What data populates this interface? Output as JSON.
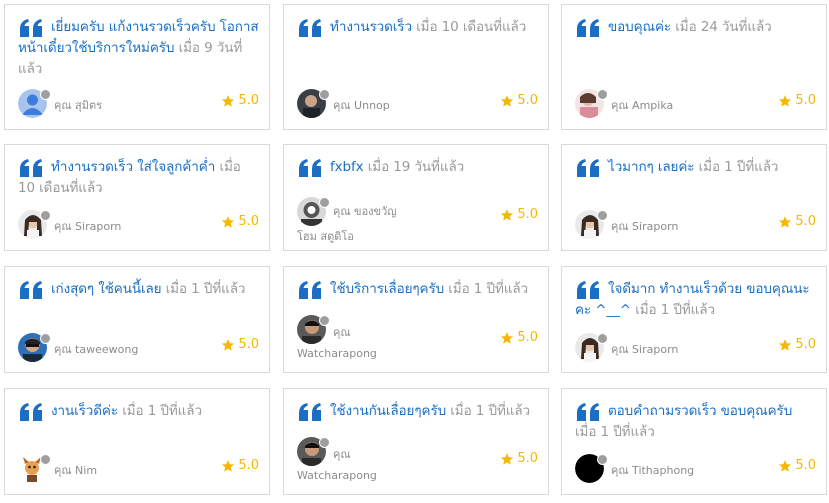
{
  "reviews": [
    {
      "text": "เยี่ยมครับ แก้งานรวดเร็วครับ โอกาสหน้าเดี๋ยวใช้บริการใหม่ครับ",
      "time": "เมื่อ 9 วันที่แล้ว",
      "user": "คุณ สุมิตร",
      "rating": "5.0",
      "avatar": "default-person"
    },
    {
      "text": "ทำงานรวดเร็ว",
      "time": "เมื่อ 10 เดือนที่แล้ว",
      "user": "คุณ Unnop",
      "rating": "5.0",
      "avatar": "photo"
    },
    {
      "text": "ขอบคุณค่ะ",
      "time": "เมื่อ 24 วันที่แล้ว",
      "user": "คุณ Ampika",
      "rating": "5.0",
      "avatar": "photo"
    },
    {
      "text": "ทำงานรวดเร็ว ใส่ใจลูกค้าค่ำ",
      "time": "เมื่อ 10 เดือนที่แล้ว",
      "user": "คุณ Siraporn",
      "rating": "5.0",
      "avatar": "photo"
    },
    {
      "text": "fxbfx",
      "time": "เมื่อ 19 วันที่แล้ว",
      "user": "คุณ ของขวัญ",
      "user2": "โฮม สตูดิโอ",
      "rating": "5.0",
      "avatar": "photo"
    },
    {
      "text": "ไวมากๆ เลยค่ะ",
      "time": "เมื่อ 1 ปีที่แล้ว",
      "user": "คุณ Siraporn",
      "rating": "5.0",
      "avatar": "photo"
    },
    {
      "text": "เก่งสุดๆ ใช้คนนี้เลย",
      "time": "เมื่อ 1 ปีที่แล้ว",
      "user": "คุณ taweewong",
      "rating": "5.0",
      "avatar": "photo"
    },
    {
      "text": "ใช้บริการเลื่อยๆครับ",
      "time": "เมื่อ 1 ปีที่แล้ว",
      "user": "คุณ",
      "user2": "Watcharapong",
      "rating": "5.0",
      "avatar": "photo"
    },
    {
      "text": "ใจดีมาก ทำงานเร็วด้วย ขอบคุณนะคะ ^__^",
      "time": "เมื่อ 1 ปีที่แล้ว",
      "user": "คุณ Siraporn",
      "rating": "5.0",
      "avatar": "photo"
    },
    {
      "text": "งานเร็วดีค่ะ",
      "time": "เมื่อ 1 ปีที่แล้ว",
      "user": "คุณ Nim",
      "rating": "5.0",
      "avatar": "cartoon"
    },
    {
      "text": "ใช้งานกันเลื่อยๆครับ",
      "time": "เมื่อ 1 ปีที่แล้ว",
      "user": "คุณ",
      "user2": "Watcharapong",
      "rating": "5.0",
      "avatar": "photo"
    },
    {
      "text": "ตอบคำถามรวดเร็ว ขอบคุณครับ",
      "time": "เมื่อ 1 ปีที่แล้ว",
      "user": "คุณ Tithaphong",
      "rating": "5.0",
      "avatar": "black-circle"
    }
  ],
  "colors": {
    "accent": "#1a6fc4",
    "star": "#f5b800",
    "muted": "#9a9a9a",
    "border": "#d9d9d9"
  }
}
